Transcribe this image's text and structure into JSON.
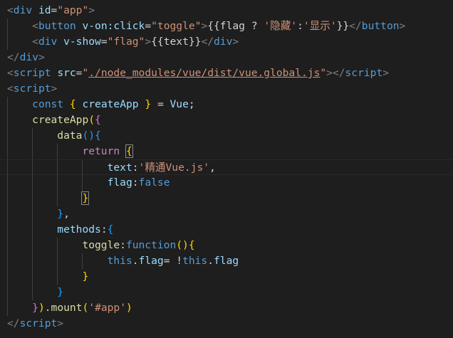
{
  "editor": {
    "theme_background": "#1e1e1e",
    "lines": [
      {
        "tokens": [
          {
            "t": "<",
            "c": "pun"
          },
          {
            "t": "div",
            "c": "tag"
          },
          {
            "t": " ",
            "c": "plain"
          },
          {
            "t": "id",
            "c": "attr"
          },
          {
            "t": "=",
            "c": "plain"
          },
          {
            "t": "\"app\"",
            "c": "str"
          },
          {
            "t": ">",
            "c": "pun"
          }
        ]
      },
      {
        "guides": [
          0
        ],
        "tokens": [
          {
            "t": "    ",
            "c": "plain"
          },
          {
            "t": "<",
            "c": "pun"
          },
          {
            "t": "button",
            "c": "tag"
          },
          {
            "t": " ",
            "c": "plain"
          },
          {
            "t": "v-on:click",
            "c": "attr"
          },
          {
            "t": "=",
            "c": "plain"
          },
          {
            "t": "\"toggle\"",
            "c": "str"
          },
          {
            "t": ">",
            "c": "pun"
          },
          {
            "t": "{{flag ? ",
            "c": "plain"
          },
          {
            "t": "'隐藏'",
            "c": "str"
          },
          {
            "t": ":",
            "c": "plain"
          },
          {
            "t": "'显示'",
            "c": "str"
          },
          {
            "t": "}}",
            "c": "plain"
          },
          {
            "t": "</",
            "c": "pun"
          },
          {
            "t": "button",
            "c": "tag"
          },
          {
            "t": ">",
            "c": "pun"
          }
        ]
      },
      {
        "guides": [
          0
        ],
        "tokens": [
          {
            "t": "    ",
            "c": "plain"
          },
          {
            "t": "<",
            "c": "pun"
          },
          {
            "t": "div",
            "c": "tag"
          },
          {
            "t": " ",
            "c": "plain"
          },
          {
            "t": "v-show",
            "c": "attr"
          },
          {
            "t": "=",
            "c": "plain"
          },
          {
            "t": "\"flag\"",
            "c": "str"
          },
          {
            "t": ">",
            "c": "pun"
          },
          {
            "t": "{{text}}",
            "c": "plain"
          },
          {
            "t": "</",
            "c": "pun"
          },
          {
            "t": "div",
            "c": "tag"
          },
          {
            "t": ">",
            "c": "pun"
          }
        ]
      },
      {
        "tokens": [
          {
            "t": "</",
            "c": "pun"
          },
          {
            "t": "div",
            "c": "tag"
          },
          {
            "t": ">",
            "c": "pun"
          }
        ]
      },
      {
        "tokens": [
          {
            "t": "<",
            "c": "pun"
          },
          {
            "t": "script",
            "c": "tag"
          },
          {
            "t": " ",
            "c": "plain"
          },
          {
            "t": "src",
            "c": "attr"
          },
          {
            "t": "=",
            "c": "plain"
          },
          {
            "t": "\"",
            "c": "str"
          },
          {
            "t": "./node_modules/vue/dist/vue.global.js",
            "c": "link"
          },
          {
            "t": "\"",
            "c": "str"
          },
          {
            "t": "></",
            "c": "pun"
          },
          {
            "t": "script",
            "c": "tag"
          },
          {
            "t": ">",
            "c": "pun"
          }
        ]
      },
      {
        "tokens": [
          {
            "t": "<",
            "c": "pun"
          },
          {
            "t": "script",
            "c": "tag"
          },
          {
            "t": ">",
            "c": "pun"
          }
        ]
      },
      {
        "guides": [
          0
        ],
        "tokens": [
          {
            "t": "    ",
            "c": "plain"
          },
          {
            "t": "const",
            "c": "kw"
          },
          {
            "t": " ",
            "c": "plain"
          },
          {
            "t": "{",
            "c": "b1"
          },
          {
            "t": " ",
            "c": "plain"
          },
          {
            "t": "createApp",
            "c": "var"
          },
          {
            "t": " ",
            "c": "plain"
          },
          {
            "t": "}",
            "c": "b1"
          },
          {
            "t": " = ",
            "c": "plain"
          },
          {
            "t": "Vue",
            "c": "var"
          },
          {
            "t": ";",
            "c": "plain"
          }
        ]
      },
      {
        "guides": [
          0
        ],
        "tokens": [
          {
            "t": "    ",
            "c": "plain"
          },
          {
            "t": "createApp",
            "c": "fn"
          },
          {
            "t": "(",
            "c": "b1"
          },
          {
            "t": "{",
            "c": "b2"
          }
        ]
      },
      {
        "guides": [
          0,
          1
        ],
        "tokens": [
          {
            "t": "        ",
            "c": "plain"
          },
          {
            "t": "data",
            "c": "fn"
          },
          {
            "t": "()",
            "c": "b3"
          },
          {
            "t": "{",
            "c": "b3"
          }
        ]
      },
      {
        "guides": [
          0,
          1,
          2
        ],
        "tokens": [
          {
            "t": "            ",
            "c": "plain"
          },
          {
            "t": "return",
            "c": "ctl"
          },
          {
            "t": " ",
            "c": "plain"
          },
          {
            "t": "{",
            "c": "b1",
            "m": true
          }
        ]
      },
      {
        "guides": [
          0,
          1,
          2,
          3
        ],
        "current": true,
        "tokens": [
          {
            "t": "                ",
            "c": "plain"
          },
          {
            "t": "text",
            "c": "var"
          },
          {
            "t": ":",
            "c": "plain"
          },
          {
            "t": "'精通Vue.js'",
            "c": "str"
          },
          {
            "t": ",",
            "c": "plain"
          }
        ]
      },
      {
        "guides": [
          0,
          1,
          2,
          3
        ],
        "tokens": [
          {
            "t": "                ",
            "c": "plain"
          },
          {
            "t": "flag",
            "c": "var"
          },
          {
            "t": ":",
            "c": "plain"
          },
          {
            "t": "false",
            "c": "kw"
          }
        ]
      },
      {
        "guides": [
          0,
          1,
          2
        ],
        "tokens": [
          {
            "t": "            ",
            "c": "plain"
          },
          {
            "t": "}",
            "c": "b1",
            "m": true
          }
        ]
      },
      {
        "guides": [
          0,
          1
        ],
        "tokens": [
          {
            "t": "        ",
            "c": "plain"
          },
          {
            "t": "}",
            "c": "b3"
          },
          {
            "t": ",",
            "c": "plain"
          }
        ]
      },
      {
        "guides": [
          0,
          1
        ],
        "tokens": [
          {
            "t": "        ",
            "c": "plain"
          },
          {
            "t": "methods",
            "c": "var"
          },
          {
            "t": ":",
            "c": "plain"
          },
          {
            "t": "{",
            "c": "b3"
          }
        ]
      },
      {
        "guides": [
          0,
          1,
          2
        ],
        "tokens": [
          {
            "t": "            ",
            "c": "plain"
          },
          {
            "t": "toggle",
            "c": "fn"
          },
          {
            "t": ":",
            "c": "plain"
          },
          {
            "t": "function",
            "c": "kw"
          },
          {
            "t": "()",
            "c": "b1"
          },
          {
            "t": "{",
            "c": "b1"
          }
        ]
      },
      {
        "guides": [
          0,
          1,
          2,
          3
        ],
        "tokens": [
          {
            "t": "                ",
            "c": "plain"
          },
          {
            "t": "this",
            "c": "kw"
          },
          {
            "t": ".",
            "c": "plain"
          },
          {
            "t": "flag",
            "c": "var"
          },
          {
            "t": "= !",
            "c": "plain"
          },
          {
            "t": "this",
            "c": "kw"
          },
          {
            "t": ".",
            "c": "plain"
          },
          {
            "t": "flag",
            "c": "var"
          }
        ]
      },
      {
        "guides": [
          0,
          1,
          2
        ],
        "tokens": [
          {
            "t": "            ",
            "c": "plain"
          },
          {
            "t": "}",
            "c": "b1"
          }
        ]
      },
      {
        "guides": [
          0,
          1
        ],
        "tokens": [
          {
            "t": "        ",
            "c": "plain"
          },
          {
            "t": "}",
            "c": "b3"
          }
        ]
      },
      {
        "guides": [
          0
        ],
        "tokens": [
          {
            "t": "    ",
            "c": "plain"
          },
          {
            "t": "}",
            "c": "b2"
          },
          {
            "t": ")",
            "c": "b1"
          },
          {
            "t": ".",
            "c": "plain"
          },
          {
            "t": "mount",
            "c": "fn"
          },
          {
            "t": "(",
            "c": "b1"
          },
          {
            "t": "'#app'",
            "c": "str"
          },
          {
            "t": ")",
            "c": "b1"
          }
        ]
      },
      {
        "tokens": [
          {
            "t": "</",
            "c": "pun"
          },
          {
            "t": "script",
            "c": "tag"
          },
          {
            "t": ">",
            "c": "pun"
          }
        ]
      }
    ]
  }
}
